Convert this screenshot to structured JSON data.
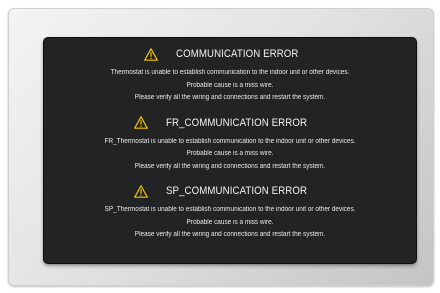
{
  "errors": [
    {
      "icon": "warning-icon",
      "title": "COMMUNICATION ERROR",
      "lines": [
        "Thermostat is unable to establish communication to the indoor unit or other devices.",
        "Probable cause is a miss wire.",
        "Please verify all the wiring and connections and restart the system."
      ]
    },
    {
      "icon": "warning-icon",
      "title": "FR_COMMUNICATION ERROR",
      "lines": [
        "FR_Thermostat is unable to establish communication to the indoor unit or other devices.",
        "Probable cause is a miss wire.",
        "Please verify all the wiring and connections and restart the system."
      ]
    },
    {
      "icon": "warning-icon",
      "title": "SP_COMMUNICATION ERROR",
      "lines": [
        "SP_Thermostat is unable to establish communication to the indoor unit or other devices.",
        "Probable cause is a miss wire.",
        "Please verify all the wiring and connections and restart the system."
      ]
    }
  ],
  "colors": {
    "screen_background": "#222324",
    "text": "#f2f2f2",
    "warning_icon": "#f2c200"
  }
}
